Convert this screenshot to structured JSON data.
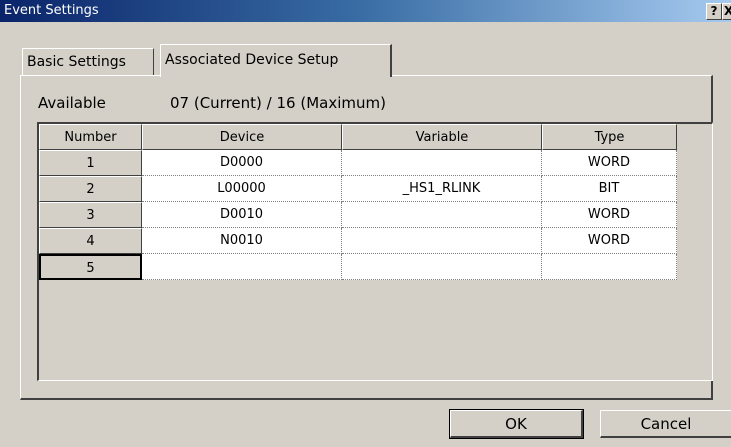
{
  "window": {
    "title": "Event Settings",
    "help_label": "?",
    "close_label": "X"
  },
  "tabs": [
    {
      "label": "Basic Settings",
      "active": false
    },
    {
      "label": "Associated Device Setup",
      "active": true
    }
  ],
  "summary": {
    "available_label": "Available",
    "counts_text": "07 (Current)  /  16 (Maximum)"
  },
  "table": {
    "columns": [
      "Number",
      "Device",
      "Variable",
      "Type"
    ],
    "rows": [
      {
        "number": "1",
        "device": "D0000",
        "variable": "",
        "type": "WORD"
      },
      {
        "number": "2",
        "device": "L00000",
        "variable": "_HS1_RLINK",
        "type": "BIT"
      },
      {
        "number": "3",
        "device": "D0010",
        "variable": "",
        "type": "WORD"
      },
      {
        "number": "4",
        "device": "N0010",
        "variable": "",
        "type": "WORD"
      },
      {
        "number": "5",
        "device": "",
        "variable": "",
        "type": ""
      }
    ]
  },
  "buttons": {
    "ok": "OK",
    "cancel": "Cancel"
  }
}
